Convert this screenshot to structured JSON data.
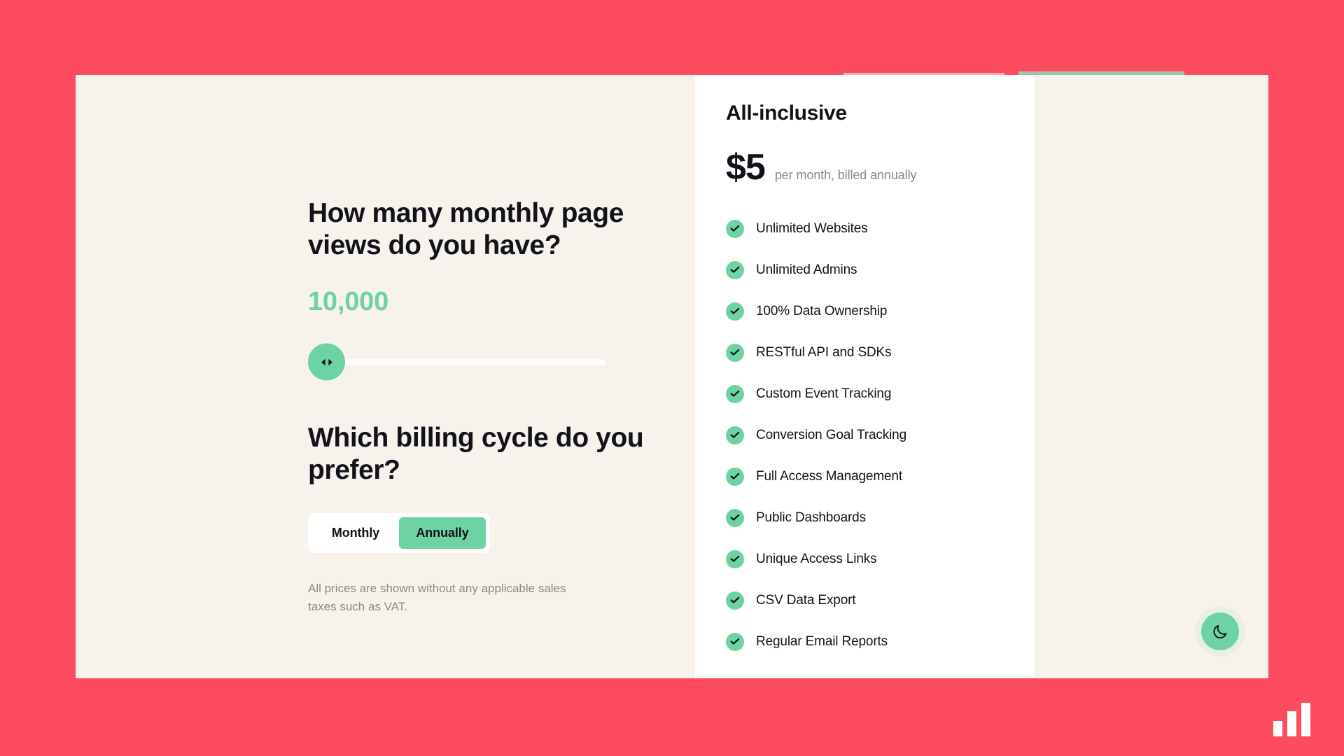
{
  "theme": {
    "page_background": "#fd4c5f",
    "card_background": "#f7f2ec",
    "panel_background": "#ffffff",
    "accent_green": "#6dd3a3",
    "text_primary": "#12131a",
    "text_muted": "#8d8781"
  },
  "configurator": {
    "pageviews_question": "How many monthly page views do you have?",
    "pageviews_value": "10,000",
    "slider": {
      "thumb_icon": "left-right-arrows-icon",
      "position_percent": 0
    },
    "billing_question": "Which billing cycle do you prefer?",
    "billing_options": [
      {
        "label": "Monthly",
        "selected": false
      },
      {
        "label": "Annually",
        "selected": true
      }
    ],
    "fineprint": "All prices are shown without any applicable sales taxes such as VAT."
  },
  "plan": {
    "name": "All-inclusive",
    "price": "$5",
    "price_note": "per month, billed annually",
    "features": [
      "Unlimited Websites",
      "Unlimited Admins",
      "100% Data Ownership",
      "RESTful API and SDKs",
      "Custom Event Tracking",
      "Conversion Goal Tracking",
      "Full Access Management",
      "Public Dashboards",
      "Unique Access Links",
      "CSV Data Export",
      "Regular Email Reports"
    ]
  },
  "controls": {
    "theme_toggle_icon": "moon-icon",
    "brand_logo_icon": "bar-chart-logo-icon"
  }
}
